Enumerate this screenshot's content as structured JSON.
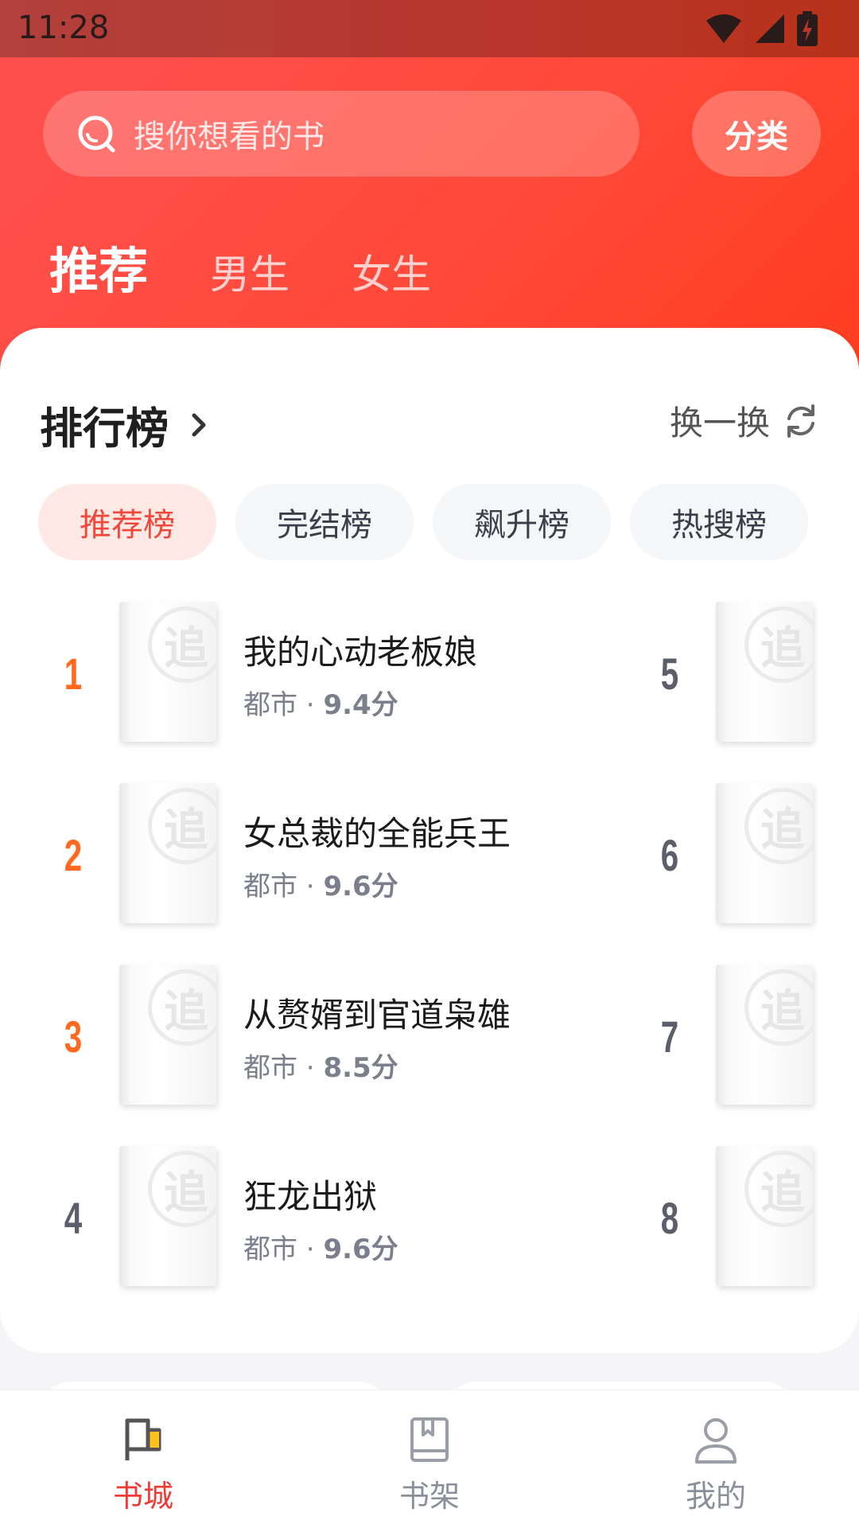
{
  "status_bar": {
    "time": "11:28"
  },
  "search": {
    "placeholder": "搜你想看的书",
    "category_label": "分类"
  },
  "top_tabs": [
    {
      "label": "推荐",
      "active": true
    },
    {
      "label": "男生",
      "active": false
    },
    {
      "label": "女生",
      "active": false
    }
  ],
  "ranking": {
    "title": "排行榜",
    "refresh_label": "换一换",
    "chips": [
      {
        "label": "推荐榜",
        "active": true
      },
      {
        "label": "完结榜",
        "active": false
      },
      {
        "label": "飙升榜",
        "active": false
      },
      {
        "label": "热搜榜",
        "active": false
      }
    ],
    "left_column": [
      {
        "rank": "1",
        "title": "我的心动老板娘",
        "genre": "都市",
        "score": "9.4分"
      },
      {
        "rank": "2",
        "title": "女总裁的全能兵王",
        "genre": "都市",
        "score": "9.6分"
      },
      {
        "rank": "3",
        "title": "从赘婿到官道枭雄",
        "genre": "都市",
        "score": "8.5分"
      },
      {
        "rank": "4",
        "title": "狂龙出狱",
        "genre": "都市",
        "score": "9.6分"
      }
    ],
    "right_column": [
      {
        "rank": "5"
      },
      {
        "rank": "6"
      },
      {
        "rank": "7"
      },
      {
        "rank": "8"
      }
    ],
    "cover_stamp": "追"
  },
  "bottom_nav": [
    {
      "label": "书城",
      "icon": "flag-icon",
      "active": true
    },
    {
      "label": "书架",
      "icon": "book-icon",
      "active": false
    },
    {
      "label": "我的",
      "icon": "person-icon",
      "active": false
    }
  ],
  "colors": {
    "accent": "#ff4a3b",
    "rank_hot": "#ff6a1f",
    "rank_cold": "#5b5f6b",
    "nav_active": "#ef3a35"
  }
}
